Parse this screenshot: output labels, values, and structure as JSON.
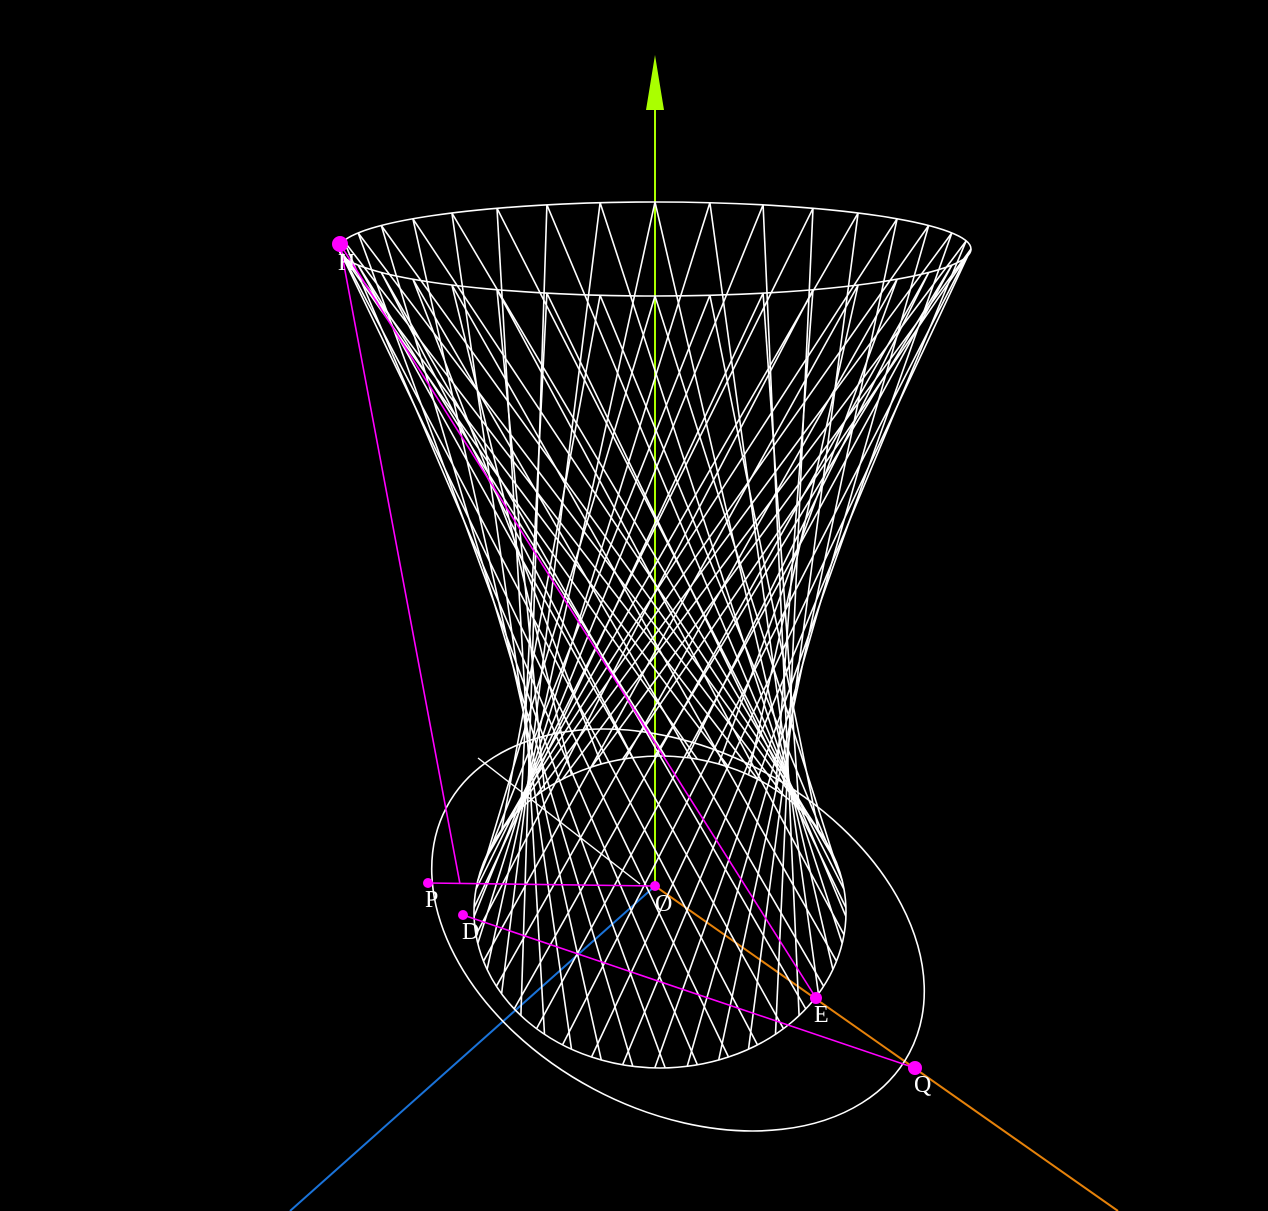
{
  "labels": {
    "H": "H",
    "P": "P",
    "D": "D",
    "O": "O",
    "E": "E",
    "Q": "Q"
  },
  "colors": {
    "background": "#000000",
    "surface_lines": "#ffffff",
    "construction": "#ff00ff",
    "vertical_axis": "#aaff00",
    "axis_left": "#1a73d9",
    "axis_right": "#e6820a",
    "label_text": "#ffffff"
  },
  "diagram": {
    "description_type": "3D wireframe hyperboloid of one sheet with coordinate axes and labeled construction points",
    "points": [
      "H",
      "P",
      "D",
      "O",
      "E",
      "Q"
    ]
  }
}
